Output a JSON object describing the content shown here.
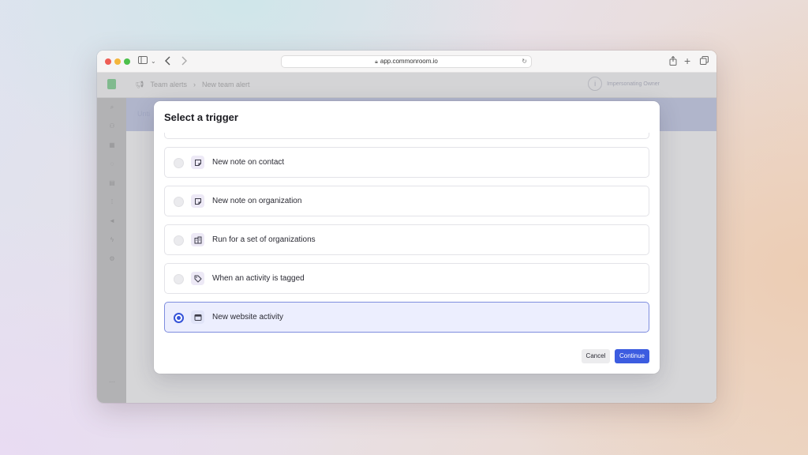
{
  "browser": {
    "url": "app.commonroom.io"
  },
  "app": {
    "breadcrumbs": [
      "Team alerts",
      "New team alert"
    ],
    "impersonation_label": "Impersonating Owner",
    "main_band_text": "Unti"
  },
  "modal": {
    "title": "Select a trigger",
    "options": [
      {
        "label": "New note on contact",
        "icon": "note-icon",
        "selected": false
      },
      {
        "label": "New note on organization",
        "icon": "note-icon",
        "selected": false
      },
      {
        "label": "Run for a set of organizations",
        "icon": "building-icon",
        "selected": false
      },
      {
        "label": "When an activity is tagged",
        "icon": "tag-icon",
        "selected": false
      },
      {
        "label": "New website activity",
        "icon": "browser-window-icon",
        "selected": true
      }
    ],
    "cancel_label": "Cancel",
    "continue_label": "Continue"
  },
  "colors": {
    "accent": "#3c5ce0",
    "selected_bg": "#eceefe"
  }
}
